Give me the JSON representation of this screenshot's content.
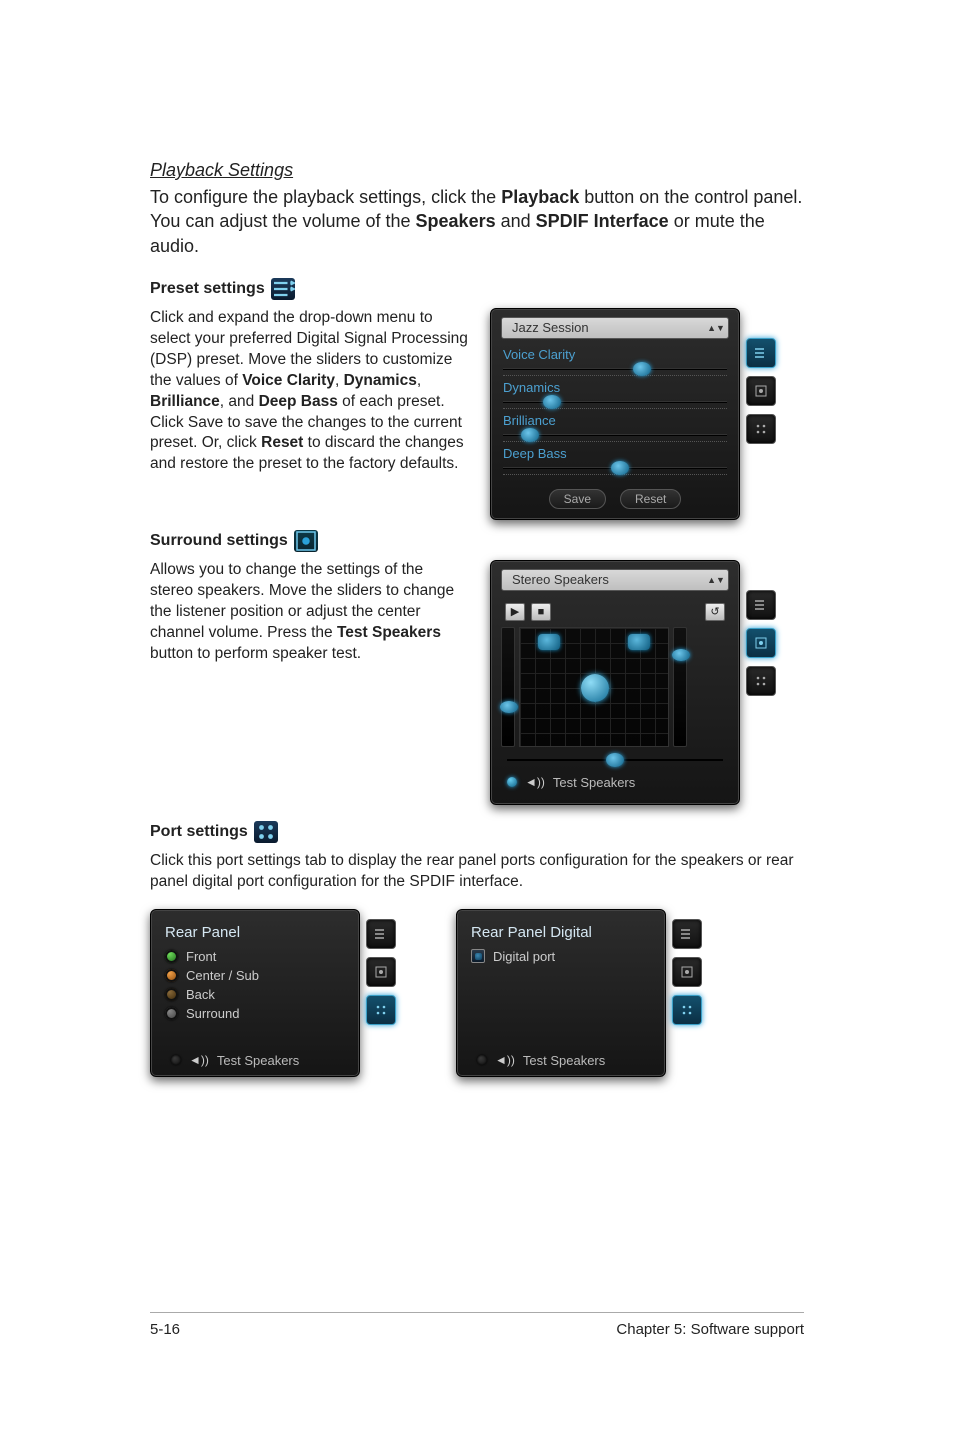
{
  "section_title": "Playback Settings",
  "intro_parts": [
    "To configure the playback settings, click the ",
    "Playback",
    " button on the control panel. You can adjust the volume of the ",
    "Speakers",
    " and ",
    "SPDIF Interface",
    " or mute the audio."
  ],
  "preset": {
    "heading": "Preset settings",
    "desc_parts": [
      "Click and expand the drop-down menu to select your preferred Digital Signal Processing (DSP) preset. Move the sliders to customize the values of ",
      "Voice Clarity",
      ", ",
      "Dynamics",
      ", ",
      "Brilliance",
      ", and ",
      "Deep Bass",
      " of each preset. Click Save to save the changes to the current preset. Or, click ",
      "Reset",
      " to discard the changes and restore the preset to the factory defaults."
    ],
    "dropdown": "Jazz Session",
    "sliders": [
      {
        "label": "Voice Clarity",
        "pos": 58
      },
      {
        "label": "Dynamics",
        "pos": 18
      },
      {
        "label": "Brilliance",
        "pos": 8
      },
      {
        "label": "Deep Bass",
        "pos": 48
      }
    ],
    "save_label": "Save",
    "reset_label": "Reset"
  },
  "surround": {
    "heading": "Surround settings",
    "desc_parts": [
      "Allows you to change the settings of the stereo speakers. Move the sliders to change the listener position or adjust the center channel volume. Press the ",
      "Test Speakers",
      " button to perform speaker test."
    ],
    "dropdown": "Stereo Speakers",
    "test_label": "Test Speakers"
  },
  "port": {
    "heading": "Port settings",
    "desc": "Click this port settings tab to display the rear panel ports configuration for the speakers or rear panel digital port configuration for the SPDIF interface.",
    "rear": {
      "title": "Rear Panel",
      "items": [
        "Front",
        "Center / Sub",
        "Back",
        "Surround"
      ],
      "test_label": "Test Speakers"
    },
    "digital": {
      "title": "Rear Panel Digital",
      "item": "Digital port",
      "test_label": "Test Speakers"
    }
  },
  "footer": {
    "left": "5-16",
    "right": "Chapter 5: Software support"
  }
}
